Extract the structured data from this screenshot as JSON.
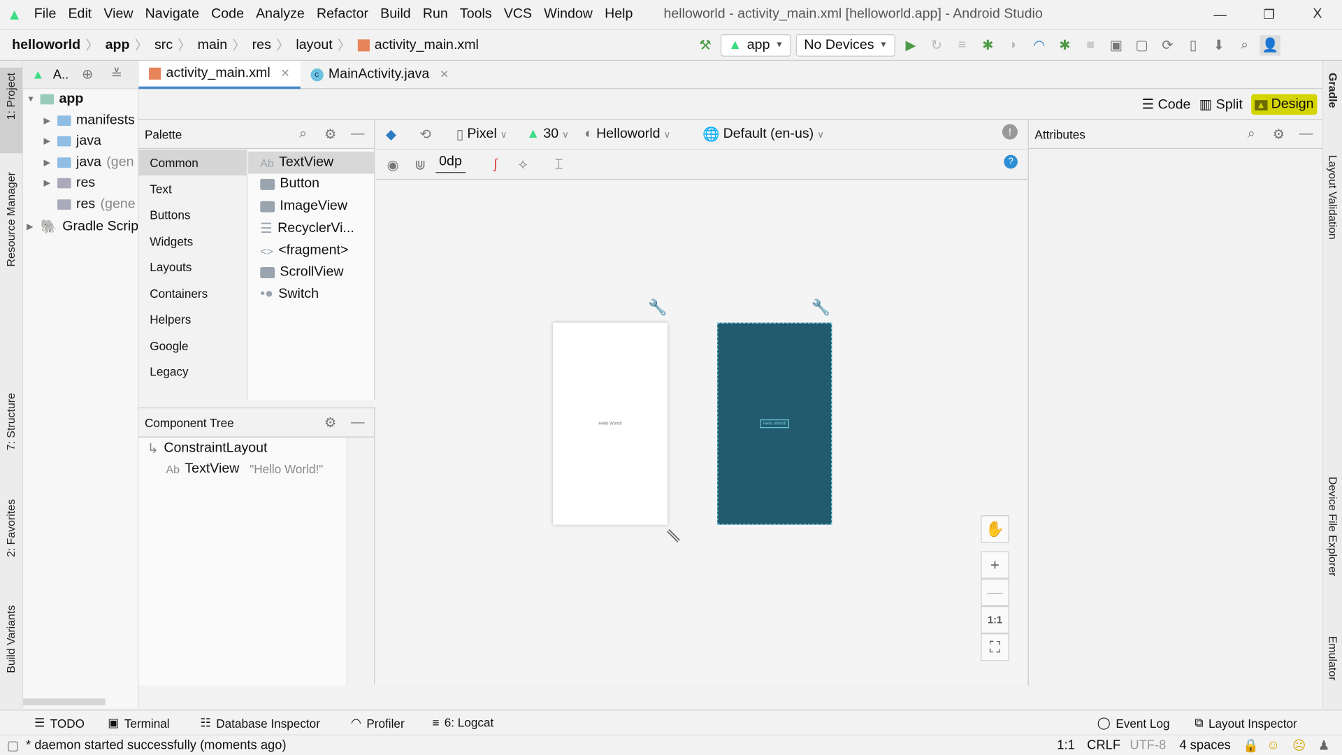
{
  "window": {
    "title": "helloworld - activity_main.xml [helloworld.app] - Android Studio",
    "minimize": "—",
    "restore": "❐",
    "close": "X"
  },
  "menu": [
    "File",
    "Edit",
    "View",
    "Navigate",
    "Code",
    "Analyze",
    "Refactor",
    "Build",
    "Run",
    "Tools",
    "VCS",
    "Window",
    "Help"
  ],
  "breadcrumb": [
    "helloworld",
    "app",
    "src",
    "main",
    "res",
    "layout",
    "activity_main.xml"
  ],
  "toolbar": {
    "run_config": "app",
    "device": "No Devices"
  },
  "left_strip": [
    "1: Project",
    "Resource Manager",
    "7: Structure",
    "2: Favorites",
    "Build Variants"
  ],
  "right_strip": [
    "Gradle",
    "Layout Validation",
    "Device File Explorer",
    "Emulator"
  ],
  "project": {
    "selector": "A..",
    "tree": [
      {
        "label": "app",
        "bold": true
      },
      {
        "label": "manifests"
      },
      {
        "label": "java"
      },
      {
        "label": "java",
        "suffix": "(gen"
      },
      {
        "label": "res"
      },
      {
        "label": "res",
        "suffix": "(gene"
      },
      {
        "label": "Gradle Scrip"
      }
    ]
  },
  "editor_tabs": [
    {
      "label": "activity_main.xml",
      "active": true
    },
    {
      "label": "MainActivity.java",
      "active": false
    }
  ],
  "view_modes": {
    "code": "Code",
    "split": "Split",
    "design": "Design",
    "active": "Design"
  },
  "palette": {
    "title": "Palette",
    "categories": [
      "Common",
      "Text",
      "Buttons",
      "Widgets",
      "Layouts",
      "Containers",
      "Helpers",
      "Google",
      "Legacy"
    ],
    "selected_category": "Common",
    "items": [
      {
        "icon": "Ab",
        "label": "TextView"
      },
      {
        "icon": "button",
        "label": "Button"
      },
      {
        "icon": "image",
        "label": "ImageView"
      },
      {
        "icon": "list",
        "label": "RecyclerVi..."
      },
      {
        "icon": "<>",
        "label": "<fragment>"
      },
      {
        "icon": "scroll",
        "label": "ScrollView"
      },
      {
        "icon": "switch",
        "label": "Switch"
      }
    ]
  },
  "design_toolbar": {
    "device": "Pixel",
    "api": "30",
    "theme": "Helloworld",
    "locale": "Default (en-us)",
    "margin": "0dp"
  },
  "component_tree": {
    "title": "Component Tree",
    "root": "ConstraintLayout",
    "child_type": "TextView",
    "child_text": "\"Hello World!\"",
    "child_icon": "Ab"
  },
  "canvas": {
    "hello": "Hello World!",
    "blueprint_color": "#225b6d"
  },
  "zoom_controls": {
    "plus": "+",
    "minus": "—",
    "one_to_one": "1:1"
  },
  "attributes": {
    "title": "Attributes"
  },
  "bottom_tools": [
    "TODO",
    "Terminal",
    "Database Inspector",
    "Profiler",
    "6: Logcat"
  ],
  "bottom_right_tools": [
    "Event Log",
    "Layout Inspector"
  ],
  "status": {
    "message": "* daemon started successfully (moments ago)",
    "position": "1:1",
    "line_sep": "CRLF",
    "encoding": "UTF-8",
    "indent": "4 spaces"
  },
  "colors": {
    "android_green": "#3ddc84",
    "design_highlight": "#d4d400",
    "accent_blue": "#4a88c7"
  }
}
